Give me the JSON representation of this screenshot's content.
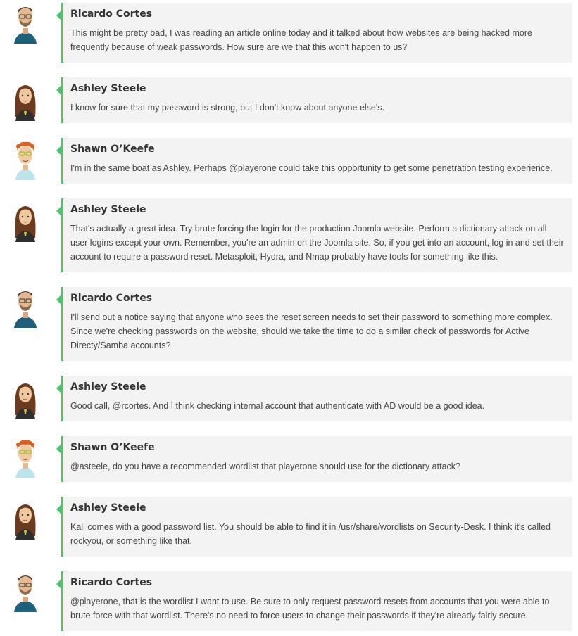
{
  "chat": {
    "accent_color": "#4fc16f",
    "bubble_color": "#f3f3f3",
    "messages": [
      {
        "author": "Ricardo Cortes",
        "avatar_icon": "ricardo-avatar-icon",
        "text": "This might be pretty bad, I was reading an article online today and it talked about how websites are being hacked more frequently because of weak passwords. How sure are we that this won't happen to us?"
      },
      {
        "author": "Ashley Steele",
        "avatar_icon": "ashley-avatar-icon",
        "text": "I know for sure that my password is strong, but I don't know about anyone else's."
      },
      {
        "author": "Shawn O’Keefe",
        "avatar_icon": "shawn-avatar-icon",
        "text": "I'm in the same boat as Ashley. Perhaps @playerone could take this opportunity to get some penetration testing experience."
      },
      {
        "author": "Ashley Steele",
        "avatar_icon": "ashley-avatar-icon",
        "text": "That's actually a great idea. Try brute forcing the login for the production Joomla website. Perform a dictionary attack on all user logins except your own. Remember, you're an admin on the Joomla site. So, if you get into an account, log in and set their account to require a password reset. Metasploit, Hydra, and Nmap probably have tools for something like this."
      },
      {
        "author": "Ricardo Cortes",
        "avatar_icon": "ricardo-avatar-icon",
        "text": "I'll send out a notice saying that anyone who sees the reset screen needs to set their password to something more complex. Since we're checking passwords on the website, should we take the time to do a similar check of passwords for Active Directy/Samba accounts?"
      },
      {
        "author": "Ashley Steele",
        "avatar_icon": "ashley-avatar-icon",
        "text": "Good call, @rcortes. And I think checking internal account that authenticate with AD would be a good idea."
      },
      {
        "author": "Shawn O’Keefe",
        "avatar_icon": "shawn-avatar-icon",
        "text": "@asteele, do you have a recommended wordlist that playerone should use for the dictionary attack?"
      },
      {
        "author": "Ashley Steele",
        "avatar_icon": "ashley-avatar-icon",
        "text": "Kali comes with a good password list. You should be able to find it in /usr/share/wordlists on Security-Desk. I think it's called rockyou, or something like that."
      },
      {
        "author": "Ricardo Cortes",
        "avatar_icon": "ricardo-avatar-icon",
        "text": "@playerone, that is the wordlist I want to use. Be sure to only request password resets from accounts that you were able to brute force with that wordlist. There's no need to force users to change their passwords if they're already fairly secure."
      }
    ]
  }
}
